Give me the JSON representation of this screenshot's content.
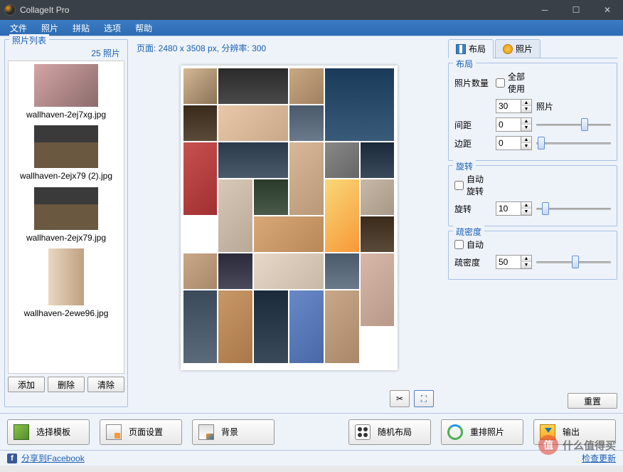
{
  "window": {
    "title": "CollageIt Pro"
  },
  "menu": {
    "file": "文件",
    "photo": "照片",
    "collage": "拼贴",
    "options": "选项",
    "help": "帮助"
  },
  "left": {
    "title": "照片列表",
    "count": "25 照片",
    "items": [
      {
        "name": "wallhaven-2ej7xg.jpg"
      },
      {
        "name": "wallhaven-2ejx79 (2).jpg"
      },
      {
        "name": "wallhaven-2ejx79.jpg"
      },
      {
        "name": "wallhaven-2ewe96.jpg"
      }
    ],
    "add": "添加",
    "delete": "删除",
    "clear": "清除"
  },
  "center": {
    "page_info": "页面: 2480 x 3508 px, 分辨率: 300"
  },
  "right": {
    "tab_layout": "布局",
    "tab_photo": "照片",
    "layout": {
      "title": "布局",
      "photo_count_label": "照片数量",
      "use_all": "全部使用",
      "count_value": "30",
      "photo_suffix": "照片",
      "spacing_label": "间距",
      "spacing_value": "0",
      "margin_label": "边距",
      "margin_value": "0"
    },
    "rotation": {
      "title": "旋转",
      "auto": "自动旋转",
      "label": "旋转",
      "value": "10"
    },
    "sparse": {
      "title": "疏密度",
      "auto": "自动",
      "label": "疏密度",
      "value": "50"
    },
    "reset": "重置"
  },
  "bottom": {
    "template": "选择模板",
    "page_setup": "页面设置",
    "background": "背景",
    "shuffle": "随机布局",
    "rearrange": "重排照片",
    "export": "输出"
  },
  "status": {
    "fb": "分享到Facebook",
    "check_update": "检查更新"
  },
  "watermark": "什么值得买"
}
